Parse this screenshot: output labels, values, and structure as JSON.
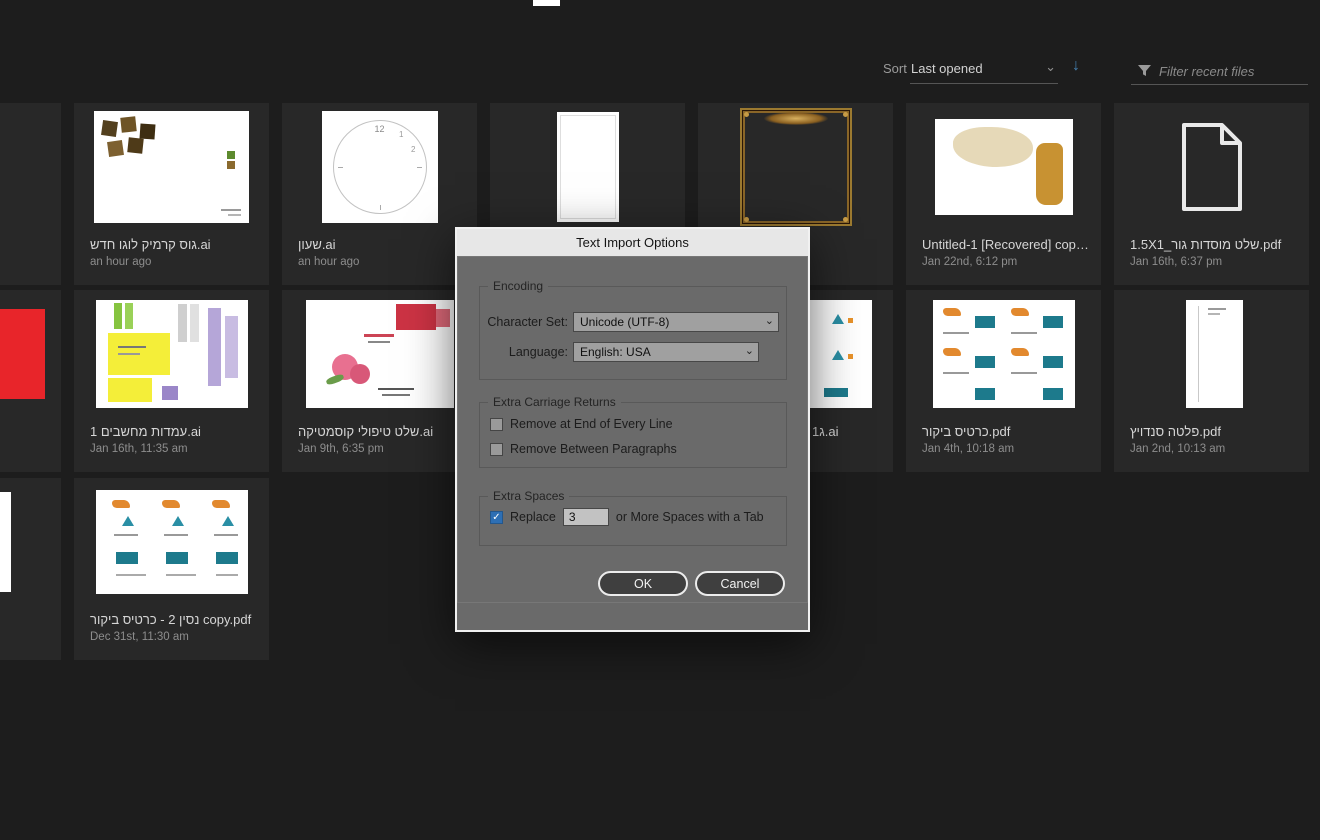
{
  "topbar": {
    "sort_label": "Sort",
    "sort_value": "Last opened",
    "filter_placeholder": "Filter recent files"
  },
  "icons": {
    "chevron_glyph": "⌄",
    "sort_direction_glyph": "↓"
  },
  "files": [
    {
      "name": "גוס קרמיק לוגו חדש.ai",
      "date": "an hour ago"
    },
    {
      "name": "שעון.ai",
      "date": "an hour ago"
    },
    {
      "name": "Untitled-1 [Recovered] cop…",
      "date": "Jan 22nd, 6:12 pm"
    },
    {
      "name": "1.5X1_שלט מוסדות גור.pdf",
      "date": "Jan 16th, 6:37 pm"
    },
    {
      "name": "עמדות מחשבים 1.ai",
      "date": "Jan 16th, 11:35 am"
    },
    {
      "name": "שלט טיפולי קוסמטיקה.ai",
      "date": "Jan 9th, 6:35 pm"
    },
    {
      "name": "ג1.ai",
      "date": ""
    },
    {
      "name": "כרטיס ביקור.pdf",
      "date": "Jan 4th, 10:18 am"
    },
    {
      "name": "פלטה סנדויץ.pdf",
      "date": "Jan 2nd, 10:13 am"
    },
    {
      "name": "נסין 2 - כרטיס ביקור copy.pdf",
      "date": "Dec 31st, 11:30 am"
    }
  ],
  "dialog": {
    "title": "Text Import Options",
    "encoding": {
      "title": "Encoding",
      "character_set_label": "Character Set:",
      "character_set_value": "Unicode (UTF-8)",
      "language_label": "Language:",
      "language_value": "English: USA"
    },
    "carriage": {
      "title": "Extra Carriage Returns",
      "option1": "Remove at End of Every Line",
      "option1_checked": false,
      "option2": "Remove Between Paragraphs",
      "option2_checked": false
    },
    "spaces": {
      "title": "Extra Spaces",
      "replace_label": "Replace",
      "replace_checked": true,
      "replace_value": "3",
      "suffix_label": "or More Spaces with a Tab"
    },
    "ok_label": "OK",
    "cancel_label": "Cancel"
  }
}
